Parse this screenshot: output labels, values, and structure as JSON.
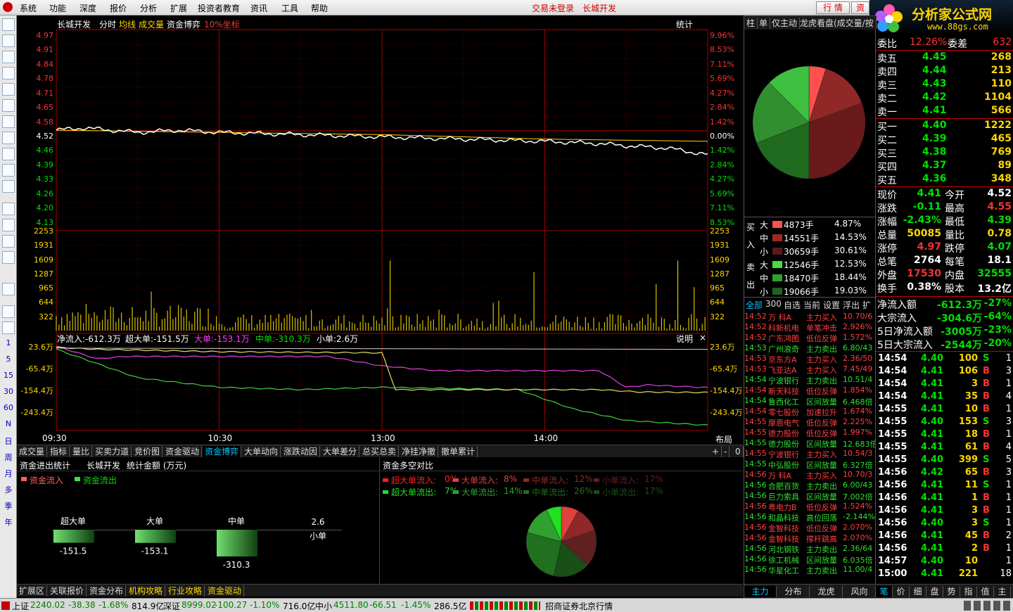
{
  "menu": {
    "items": [
      "系统",
      "功能",
      "深度",
      "报价",
      "分析",
      "扩展",
      "投资者教育",
      "资讯",
      "工具",
      "帮助"
    ],
    "login_status": "交易未登录",
    "stock_name": "长城开发",
    "btn_quote": "行 情",
    "btn_trade": "资"
  },
  "logo": {
    "title": "分析家公式网",
    "url": "www.88gs.com"
  },
  "left_toolbar": {
    "periods": [
      "1",
      "5",
      "15",
      "30",
      "60",
      "N",
      "日",
      "周",
      "月",
      "多",
      "季",
      "年"
    ]
  },
  "chart_header": {
    "stock": "长城开发",
    "mode": "分时",
    "avg_line": "均线",
    "volume": "成交量",
    "game": "资金博弈",
    "coord": "10%坐标",
    "stat": "统计"
  },
  "price_axis": {
    "left": [
      "4.97",
      "4.91",
      "4.84",
      "4.78",
      "4.71",
      "4.65",
      "4.58",
      "4.52",
      "4.46",
      "4.39",
      "4.33",
      "4.26",
      "4.20",
      "4.13"
    ],
    "right": [
      "9.96%",
      "8.53%",
      "7.11%",
      "5.69%",
      "4.27%",
      "2.84%",
      "1.42%",
      "0.00%",
      "1.42%",
      "2.84%",
      "4.27%",
      "5.69%",
      "7.11%",
      "8.53%"
    ],
    "prev_close": "4.52"
  },
  "volume_axis": [
    "2253",
    "1931",
    "1609",
    "1287",
    "965",
    "644",
    "322"
  ],
  "fund_header": {
    "net": "净流入:-612.3万",
    "super": "超大单:-151.5万",
    "big": "大单:-153.1万",
    "mid": "中单:-310.3万",
    "small": "小单:2.6万",
    "explain": "说明"
  },
  "fund_axis": [
    "23.6万",
    "-65.4万",
    "-154.4万",
    "-243.4万"
  ],
  "time_axis": [
    "09:30",
    "10:30",
    "13:00",
    "14:00"
  ],
  "layout_label": "布局",
  "bottom_tabs": [
    "成交量",
    "指标",
    "量比",
    "买卖力道",
    "竞价图",
    "资金驱动",
    "资金博弈",
    "大单动向",
    "涨跌动因",
    "大单差分",
    "总买总卖",
    "净挂净撤",
    "撤单累计"
  ],
  "bottom_tabs_active": "资金博弈",
  "stats_panel": {
    "title": "资金进出统计",
    "stock": "长城开发",
    "unit": "统计金额 (万元)",
    "legend_in": "资金流入",
    "legend_out": "资金流出",
    "bars": [
      {
        "label": "超大单",
        "value": "-151.5",
        "amount": -151.5
      },
      {
        "label": "大单",
        "value": "-153.1",
        "amount": -153.1
      },
      {
        "label": "中单",
        "value": "-310.3",
        "amount": -310.3
      },
      {
        "label": "小单",
        "value": "2.6",
        "amount": 2.6
      }
    ]
  },
  "compare_panel": {
    "title": "资金多空对比",
    "inflow": [
      {
        "label": "超大单流入:",
        "pct": "0%",
        "color": "#ff2020"
      },
      {
        "label": "大单流入:",
        "pct": "8%",
        "color": "#e04040"
      },
      {
        "label": "中单流入:",
        "pct": "12%",
        "color": "#902828"
      },
      {
        "label": "小单流入:",
        "pct": "17%",
        "color": "#602020"
      }
    ],
    "outflow": [
      {
        "label": "超大单流出:",
        "pct": "7%",
        "color": "#20e020"
      },
      {
        "label": "大单流出:",
        "pct": "14%",
        "color": "#30a030"
      },
      {
        "label": "中单流出:",
        "pct": "26%",
        "color": "#207020"
      },
      {
        "label": "小单流出:",
        "pct": "17%",
        "color": "#185018"
      }
    ]
  },
  "bottom_left_tabs": [
    "扩展区",
    "关联报价",
    "资金分布",
    "机构攻略",
    "行业攻略",
    "资金驱动"
  ],
  "right_top_tabs": [
    "柱",
    "单",
    "仅主动",
    "龙虎看盘(成交量/按"
  ],
  "order_split": {
    "buy_side": "买入",
    "sell_side": "卖出",
    "rows": [
      {
        "size": "大",
        "vol": "4873手",
        "pct": "4.87%",
        "color": "#ff5050"
      },
      {
        "size": "中",
        "vol": "14551手",
        "pct": "14.53%",
        "color": "#a02828"
      },
      {
        "size": "小",
        "vol": "30659手",
        "pct": "30.61%",
        "color": "#5a1a1a"
      },
      {
        "size": "大",
        "vol": "12546手",
        "pct": "12.53%",
        "color": "#40e040"
      },
      {
        "size": "中",
        "vol": "18470手",
        "pct": "18.44%",
        "color": "#30a030"
      },
      {
        "size": "小",
        "vol": "19066手",
        "pct": "19.03%",
        "color": "#206020"
      }
    ]
  },
  "news_filter": [
    "全部",
    "300",
    "自选",
    "当前",
    "设置",
    "浮出",
    "扩"
  ],
  "news": [
    {
      "time": "14:52",
      "name": "万  科A",
      "type": "主力买入",
      "val": "10.70/6",
      "t": "b"
    },
    {
      "time": "14:52",
      "name": "科新机电",
      "type": "单笔冲击",
      "val": "2.926%",
      "t": "b"
    },
    {
      "time": "14:52",
      "name": "广东鸿图",
      "type": "低位反弹",
      "val": "1.572%",
      "t": "b"
    },
    {
      "time": "14:53",
      "name": "广州浪奇",
      "type": "主力卖出",
      "val": "6.80/43",
      "t": "s"
    },
    {
      "time": "14:53",
      "name": "京东方A",
      "type": "主力买入",
      "val": "2.36/50",
      "t": "b"
    },
    {
      "time": "14:53",
      "name": "飞亚达A",
      "type": "主力买入",
      "val": "7.45/49",
      "t": "b"
    },
    {
      "time": "14:54",
      "name": "宁波银行",
      "type": "主力卖出",
      "val": "10.51/4",
      "t": "s"
    },
    {
      "time": "14:54",
      "name": "新天科技",
      "type": "低位反弹",
      "val": "1.854%",
      "t": "b"
    },
    {
      "time": "14:54",
      "name": "鲁西化工",
      "type": "区间放量",
      "val": "6.468倍",
      "t": "s"
    },
    {
      "time": "14:54",
      "name": "零七股份",
      "type": "加速拉升",
      "val": "1.674%",
      "t": "b"
    },
    {
      "time": "14:55",
      "name": "摩恩电气",
      "type": "低位反弹",
      "val": "2.225%",
      "t": "b"
    },
    {
      "time": "14:55",
      "name": "德力股份",
      "type": "低位反弹",
      "val": "1.997%",
      "t": "b"
    },
    {
      "time": "14:55",
      "name": "德力股份",
      "type": "区间放量",
      "val": "12.683倍",
      "t": "s"
    },
    {
      "time": "14:55",
      "name": "宁波银行",
      "type": "主力买入",
      "val": "10.54/3",
      "t": "b"
    },
    {
      "time": "14:55",
      "name": "中弘股份",
      "type": "区间放量",
      "val": "6.327倍",
      "t": "s"
    },
    {
      "time": "14:56",
      "name": "万  科A",
      "type": "主力买入",
      "val": "10.70/3",
      "t": "b"
    },
    {
      "time": "14:56",
      "name": "合肥百货",
      "type": "主力卖出",
      "val": "6.00/43",
      "t": "s"
    },
    {
      "time": "14:56",
      "name": "巨力索具",
      "type": "区间放量",
      "val": "7.002倍",
      "t": "s"
    },
    {
      "time": "14:56",
      "name": "粤电力B",
      "type": "低位反弹",
      "val": "1.524%",
      "t": "b"
    },
    {
      "time": "14:56",
      "name": "和晶科技",
      "type": "高位回落",
      "val": "-2.144%",
      "t": "s"
    },
    {
      "time": "14:56",
      "name": "金智科技",
      "type": "低位反弹",
      "val": "2.070%",
      "t": "b"
    },
    {
      "time": "14:56",
      "name": "金智科技",
      "type": "撑杆跳高",
      "val": "2.070%",
      "t": "b"
    },
    {
      "time": "14:56",
      "name": "河北钢铁",
      "type": "主力卖出",
      "val": "2.36/64",
      "t": "s"
    },
    {
      "time": "14:56",
      "name": "徐工机械",
      "type": "区间放量",
      "val": "6.035倍",
      "t": "s"
    },
    {
      "time": "14:56",
      "name": "华星化工",
      "type": "主力卖出",
      "val": "11.00/4",
      "t": "s"
    }
  ],
  "news_bottom_tabs": [
    "主力",
    "分布",
    "龙虎",
    "风向"
  ],
  "quote": {
    "weibi_label": "委比",
    "weibi": "12.26%",
    "weicha_label": "委差",
    "weicha": "632",
    "asks": [
      {
        "label": "卖五",
        "price": "4.45",
        "vol": "268"
      },
      {
        "label": "卖四",
        "price": "4.44",
        "vol": "213"
      },
      {
        "label": "卖三",
        "price": "4.43",
        "vol": "110"
      },
      {
        "label": "卖二",
        "price": "4.42",
        "vol": "1104"
      },
      {
        "label": "卖一",
        "price": "4.41",
        "vol": "566"
      }
    ],
    "bids": [
      {
        "label": "买一",
        "price": "4.40",
        "vol": "1222"
      },
      {
        "label": "买二",
        "price": "4.39",
        "vol": "465"
      },
      {
        "label": "买三",
        "price": "4.38",
        "vol": "769"
      },
      {
        "label": "买四",
        "price": "4.37",
        "vol": "89"
      },
      {
        "label": "买五",
        "price": "4.36",
        "vol": "348"
      }
    ],
    "stats": [
      {
        "l1": "现价",
        "v1": "4.41",
        "c1": "grn",
        "l2": "今开",
        "v2": "4.52",
        "c2": "wht"
      },
      {
        "l1": "涨跌",
        "v1": "-0.11",
        "c1": "grn",
        "l2": "最高",
        "v2": "4.55",
        "c2": "red"
      },
      {
        "l1": "涨幅",
        "v1": "-2.43%",
        "c1": "grn",
        "l2": "最低",
        "v2": "4.39",
        "c2": "grn"
      },
      {
        "l1": "总量",
        "v1": "50085",
        "c1": "yel",
        "l2": "量比",
        "v2": "0.78",
        "c2": "yel"
      },
      {
        "l1": "涨停",
        "v1": "4.97",
        "c1": "red",
        "l2": "跌停",
        "v2": "4.07",
        "c2": "grn"
      },
      {
        "l1": "总笔",
        "v1": "2764",
        "c1": "wht",
        "l2": "每笔",
        "v2": "18.1",
        "c2": "wht"
      },
      {
        "l1": "外盘",
        "v1": "17530",
        "c1": "red",
        "l2": "内盘",
        "v2": "32555",
        "c2": "grn"
      },
      {
        "l1": "换手",
        "v1": "0.38%",
        "c1": "wht",
        "l2": "股本",
        "v2": "13.2亿",
        "c2": "wht"
      }
    ],
    "flows": [
      {
        "label": "净流入额",
        "val": "-612.3万",
        "pct": "-27%"
      },
      {
        "label": "大宗流入",
        "val": "-304.6万",
        "pct": "-64%"
      },
      {
        "label": "5日净流入额",
        "val": "-3005万",
        "pct": "-23%"
      },
      {
        "label": "5日大宗流入",
        "val": "-2544万",
        "pct": "-20%"
      }
    ]
  },
  "ticks": [
    {
      "t": "14:54",
      "p": "4.40",
      "v": "100",
      "s": "S",
      "n": "1"
    },
    {
      "t": "14:54",
      "p": "4.41",
      "v": "106",
      "s": "B",
      "n": "3"
    },
    {
      "t": "14:54",
      "p": "4.41",
      "v": "3",
      "s": "B",
      "n": "1"
    },
    {
      "t": "14:54",
      "p": "4.41",
      "v": "35",
      "s": "B",
      "n": "4"
    },
    {
      "t": "14:55",
      "p": "4.41",
      "v": "10",
      "s": "B",
      "n": "1"
    },
    {
      "t": "14:55",
      "p": "4.40",
      "v": "153",
      "s": "S",
      "n": "3"
    },
    {
      "t": "14:55",
      "p": "4.41",
      "v": "18",
      "s": "B",
      "n": "1"
    },
    {
      "t": "14:55",
      "p": "4.41",
      "v": "61",
      "s": "B",
      "n": "4"
    },
    {
      "t": "14:55",
      "p": "4.40",
      "v": "399",
      "s": "S",
      "n": "5"
    },
    {
      "t": "14:56",
      "p": "4.42",
      "v": "65",
      "s": "B",
      "n": "3"
    },
    {
      "t": "14:56",
      "p": "4.41",
      "v": "11",
      "s": "S",
      "n": "1"
    },
    {
      "t": "14:56",
      "p": "4.41",
      "v": "1",
      "s": "B",
      "n": "1"
    },
    {
      "t": "14:56",
      "p": "4.41",
      "v": "3",
      "s": "B",
      "n": "1"
    },
    {
      "t": "14:56",
      "p": "4.40",
      "v": "3",
      "s": "S",
      "n": "1"
    },
    {
      "t": "14:56",
      "p": "4.41",
      "v": "45",
      "s": "B",
      "n": "2"
    },
    {
      "t": "14:56",
      "p": "4.41",
      "v": "2",
      "s": "B",
      "n": "1"
    },
    {
      "t": "14:57",
      "p": "4.40",
      "v": "10",
      "s": "",
      "n": "1"
    },
    {
      "t": "15:00",
      "p": "4.41",
      "v": "221",
      "s": "",
      "n": "18"
    }
  ],
  "tick_tabs": [
    "笔",
    "价",
    "细",
    "盘",
    "势",
    "指",
    "值",
    "主"
  ],
  "statusbar": {
    "sh_label": "上证",
    "sh_val": "2240.02",
    "sh_chg": "-38.38",
    "sh_pct": "-1.68%",
    "sh_amt": "814.9亿",
    "sz_label": "深证",
    "sz_val": "8999.02",
    "sz_chg": "-100.27",
    "sz_pct": "-1.10%",
    "sz_amt": "716.0亿",
    "zx_label": "中小",
    "zx_val": "4511.80",
    "zx_chg": "-66.51",
    "zx_pct": "-1.45%",
    "zx_amt": "286.5亿",
    "broker": "招商证券北京行情"
  },
  "chart_data": {
    "type": "line",
    "prev_close": 4.52,
    "price_range": [
      4.07,
      4.97
    ],
    "volume_range": [
      0,
      2253
    ],
    "fund_range": [
      -243.4,
      23.6
    ],
    "price_key": [
      [
        0,
        4.52
      ],
      [
        10,
        4.53
      ],
      [
        20,
        4.52
      ],
      [
        30,
        4.51
      ],
      [
        45,
        4.52
      ],
      [
        60,
        4.51
      ],
      [
        90,
        4.5
      ],
      [
        120,
        4.49
      ],
      [
        150,
        4.48
      ],
      [
        180,
        4.47
      ],
      [
        200,
        4.46
      ],
      [
        210,
        4.45
      ],
      [
        225,
        4.44
      ],
      [
        235,
        4.42
      ],
      [
        240,
        4.41
      ]
    ],
    "avg_key": [
      [
        0,
        4.52
      ],
      [
        60,
        4.51
      ],
      [
        120,
        4.5
      ],
      [
        180,
        4.48
      ],
      [
        240,
        4.47
      ]
    ],
    "volume_spikes": [
      [
        123,
        1580
      ],
      [
        176,
        1320
      ],
      [
        221,
        1050
      ],
      [
        229,
        1580
      ],
      [
        235,
        980
      ]
    ],
    "net_key": [
      [
        0,
        18
      ],
      [
        15,
        10
      ],
      [
        25,
        8
      ],
      [
        60,
        0
      ],
      [
        120,
        -5
      ],
      [
        125,
        -160
      ],
      [
        200,
        -160
      ],
      [
        215,
        -170
      ],
      [
        240,
        -172
      ]
    ],
    "super_key": [
      [
        0,
        23
      ],
      [
        15,
        -30
      ],
      [
        25,
        -20
      ],
      [
        50,
        -20
      ],
      [
        100,
        -20
      ],
      [
        120,
        -60
      ],
      [
        140,
        -80
      ],
      [
        200,
        -80
      ],
      [
        210,
        -150
      ],
      [
        218,
        -140
      ],
      [
        240,
        -151.5
      ]
    ],
    "mid_key": [
      [
        0,
        10
      ],
      [
        15,
        -50
      ],
      [
        30,
        -110
      ],
      [
        60,
        -150
      ],
      [
        90,
        -160
      ],
      [
        120,
        -150
      ],
      [
        170,
        -160
      ],
      [
        190,
        -240
      ],
      [
        210,
        -290
      ],
      [
        225,
        -300
      ],
      [
        240,
        -310.3
      ]
    ]
  }
}
